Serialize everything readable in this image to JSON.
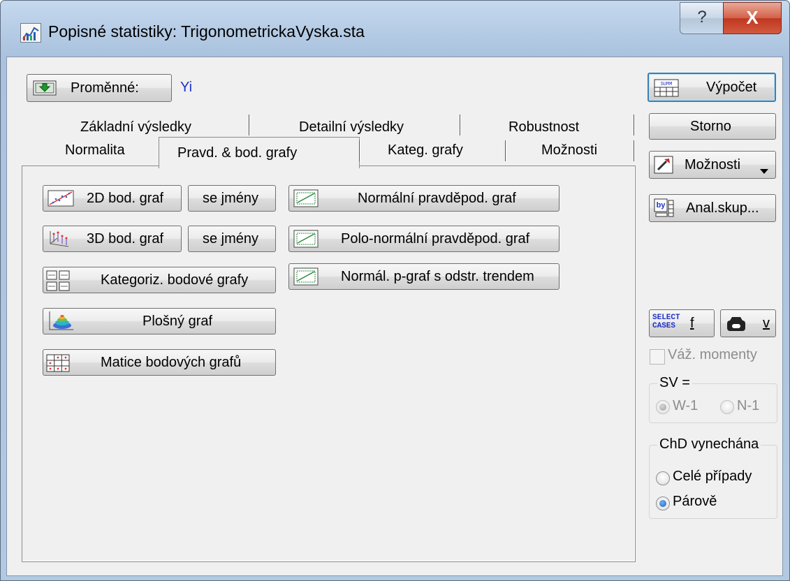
{
  "window": {
    "title": "Popisné statistiky: TrigonometrickaVyska.sta",
    "help_glyph": "?",
    "close_glyph": "X"
  },
  "variables": {
    "button_label": "Proměnné:",
    "value": "Yi"
  },
  "tabs": {
    "row_back": [
      "Základní výsledky",
      "Detailní výsledky",
      "Robustnost"
    ],
    "row_front": [
      "Normalita",
      "Pravd. & bod. grafy",
      "Kateg. grafy",
      "Možnosti"
    ],
    "active": "Pravd. & bod. grafy"
  },
  "panel": {
    "scatter2d_label": "2D bod. graf",
    "scatter2d_names_label": "se jmény",
    "scatter3d_label": "3D bod. graf",
    "scatter3d_names_label": "se jmény",
    "categorized_label": "Kategoriz. bodové grafy",
    "surface_label": "Plošný graf",
    "matrix_label": "Matice bodových grafů",
    "normal_prob_label": "Normální pravděpod. graf",
    "halfnormal_prob_label": "Polo-normální pravděpod. graf",
    "detrended_label": "Normál. p-graf s odstr. trendem"
  },
  "sidebar": {
    "compute_label": "Výpočet",
    "compute_icon_text": "SUMM",
    "cancel_label": "Storno",
    "options_label": "Možnosti",
    "group_label": "Anal.skup...",
    "group_icon_text": "by",
    "select_cases_text": "SELECT CASES",
    "select_f_label": "f",
    "weight_v_label": "v",
    "weighted_moments_label": "Váž. momenty",
    "df_group_title": "SV =",
    "df_option_1": "W-1",
    "df_option_2": "N-1",
    "df_selected": "W-1",
    "md_group_title": "ChD vynechána",
    "md_option_casewise": "Celé případy",
    "md_option_pairwise": "Párově",
    "md_selected": "Párově"
  }
}
